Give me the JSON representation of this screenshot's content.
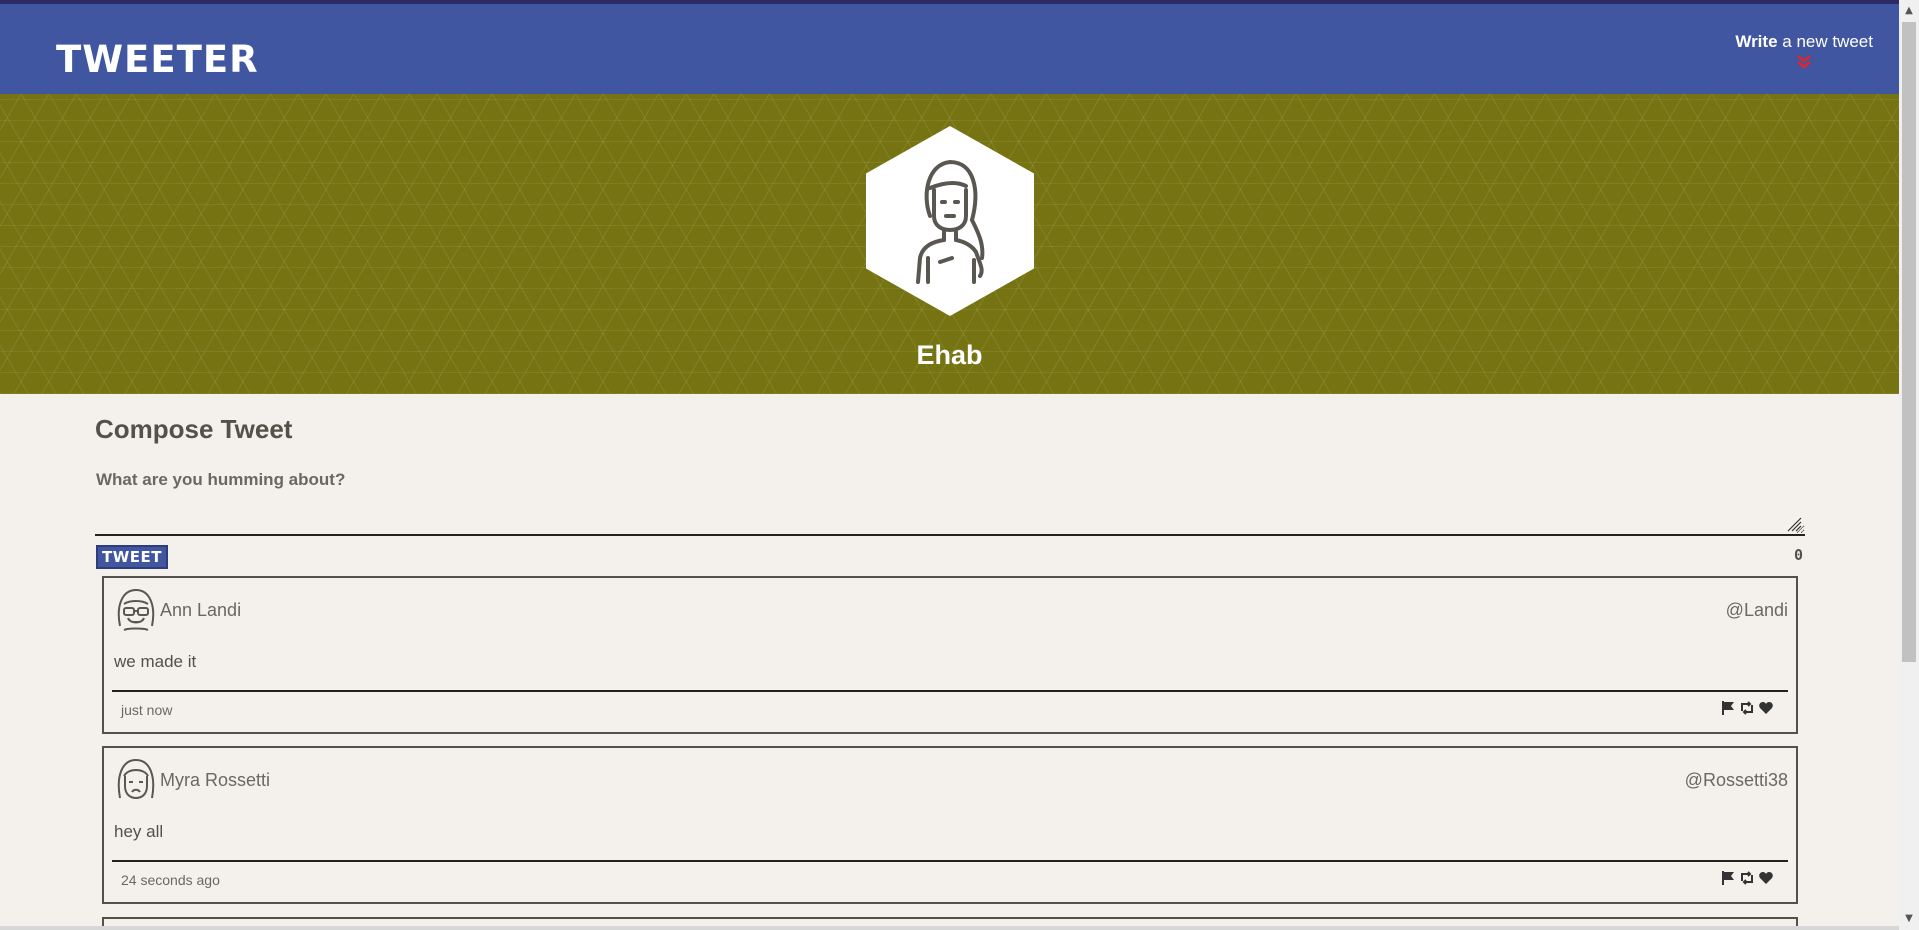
{
  "nav": {
    "logo": "TWEETER",
    "compose_bold": "Write",
    "compose_rest": "a new tweet",
    "chevron_icon": "double-chevron-down-icon",
    "chevron_color": "#e0262b"
  },
  "profile": {
    "name": "Ehab",
    "avatar_icon": "woman-avatar-icon",
    "banner_color": "#767412",
    "header_color": "#4056a1"
  },
  "compose": {
    "title": "Compose Tweet",
    "label": "What are you humming about?",
    "text_value": "",
    "button_label": "TWEET",
    "counter": "0"
  },
  "tweets": [
    {
      "author": "Ann Landi",
      "handle": "@Landi",
      "content": "we made it",
      "time": "just now",
      "avatar_icon": "woman-glasses-avatar-icon"
    },
    {
      "author": "Myra Rossetti",
      "handle": "@Rossetti38",
      "content": "hey all",
      "time": "24 seconds ago",
      "avatar_icon": "woman-sad-avatar-icon"
    }
  ],
  "action_icons": [
    "flag-icon",
    "retweet-icon",
    "heart-icon"
  ]
}
